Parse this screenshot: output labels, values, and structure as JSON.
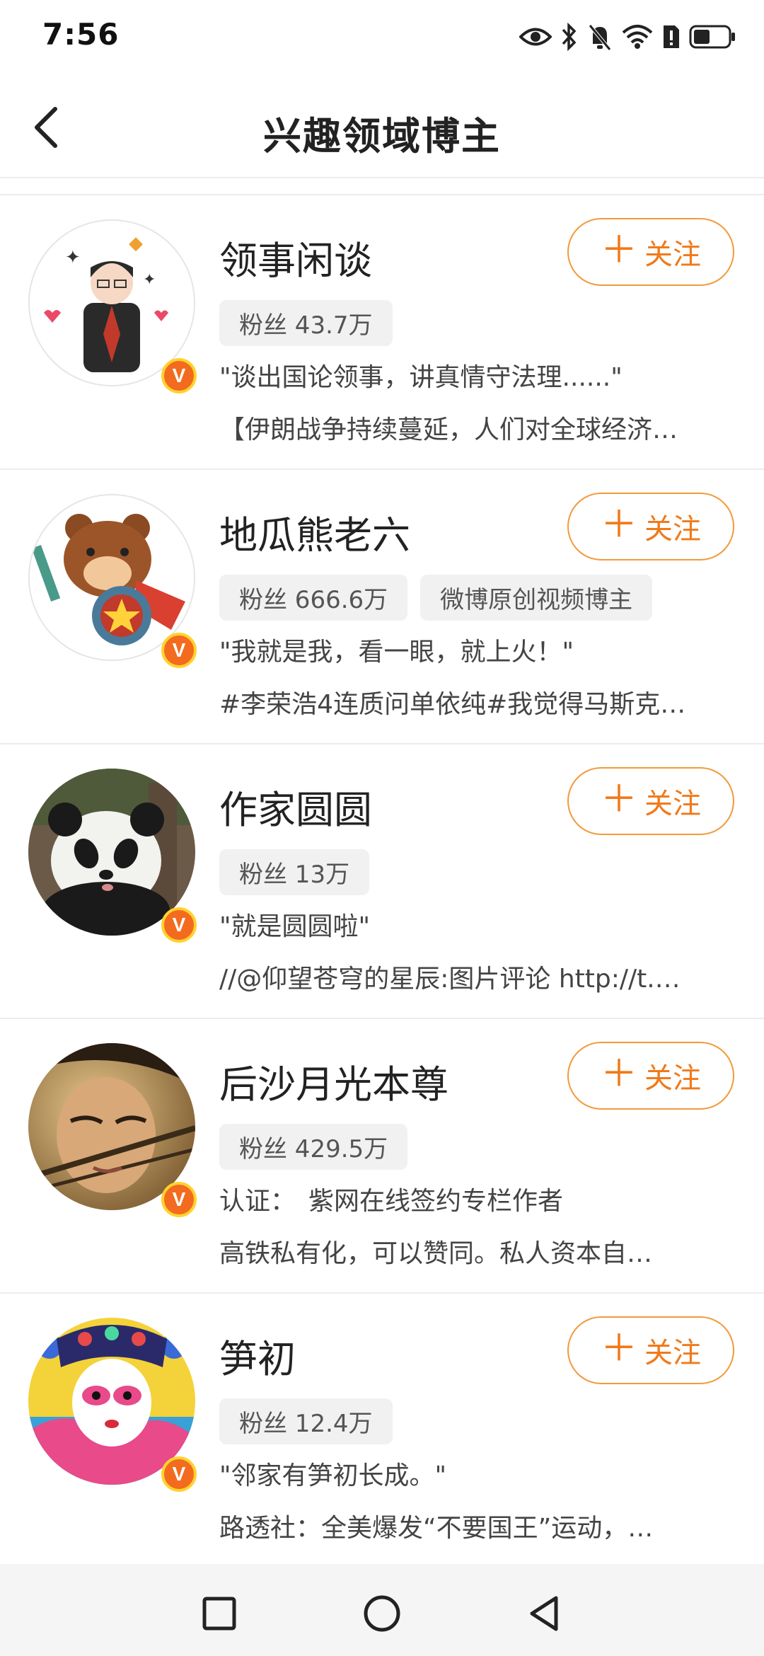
{
  "status_bar": {
    "time": "7:56"
  },
  "header": {
    "title": "兴趣领域博主"
  },
  "follow_label": "关注",
  "verified_mark": "V",
  "users": [
    {
      "name": "领事闲谈",
      "tags": [
        "粉丝 43.7万"
      ],
      "line1": "\"谈出国论领事，讲真情守法理......\"",
      "line2": "【伊朗战争持续蔓延，人们对全球经济…"
    },
    {
      "name": "地瓜熊老六",
      "tags": [
        "粉丝 666.6万",
        "微博原创视频博主"
      ],
      "line1": "\"我就是我，看一眼，就上火！\"",
      "line2": "#李荣浩4连质问单依纯#我觉得马斯克…"
    },
    {
      "name": "作家圆圆",
      "tags": [
        "粉丝 13万"
      ],
      "line1": "\"就是圆圆啦\"",
      "line2": "//@仰望苍穹的星辰:图片评论 http://t.…"
    },
    {
      "name": "后沙月光本尊",
      "tags": [
        "粉丝 429.5万"
      ],
      "line1": "认证：　紫网在线签约专栏作者",
      "line2": "高铁私有化，可以赞同。私人资本自…"
    },
    {
      "name": "笋初",
      "tags": [
        "粉丝 12.4万"
      ],
      "line1": "\"邻家有笋初长成。\"",
      "line2": "路透社：全美爆发“不要国王”运动，…"
    }
  ]
}
